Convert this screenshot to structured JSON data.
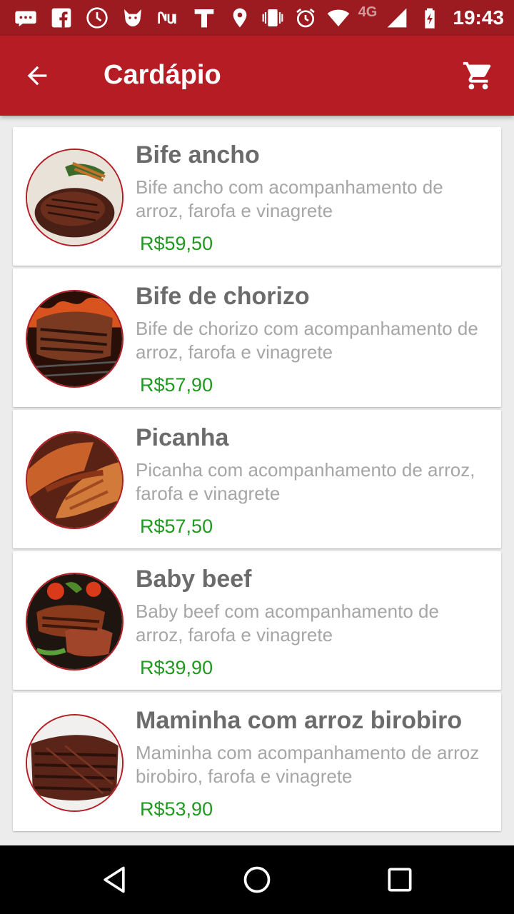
{
  "status_bar": {
    "network": "4G",
    "time": "19:43",
    "left_icons": [
      "message-icon",
      "facebook-icon",
      "clock-app-icon",
      "fox-app-icon",
      "nu-app-icon",
      "t-app-icon"
    ],
    "right_icons": [
      "location-icon",
      "vibrate-icon",
      "alarm-icon",
      "wifi-icon",
      "signal-icon",
      "battery-charging-icon"
    ]
  },
  "app_bar": {
    "title": "Cardápio",
    "back_icon": "arrow-back-icon",
    "cart_icon": "shopping-cart-icon",
    "color": "#b51c24"
  },
  "menu": {
    "items": [
      {
        "name": "Bife ancho",
        "description": "Bife ancho com acompanhamento de arroz, farofa e vinagrete",
        "price": "R$59,50"
      },
      {
        "name": "Bife de chorizo",
        "description": "Bife de chorizo com acompanhamento de arroz, farofa e vinagrete",
        "price": "R$57,90"
      },
      {
        "name": "Picanha",
        "description": "Picanha com acompanhamento de arroz, farofa e vinagrete",
        "price": "R$57,50"
      },
      {
        "name": "Baby beef",
        "description": "Baby beef com acompanhamento de arroz, farofa e vinagrete",
        "price": "R$39,90"
      },
      {
        "name": "Maminha com arroz birobiro",
        "description": "Maminha com acompanhamento de arroz birobiro, farofa e vinagrete",
        "price": "R$53,90"
      }
    ]
  },
  "nav_bar": {
    "buttons": [
      "back-triangle-icon",
      "home-circle-icon",
      "recents-square-icon"
    ]
  },
  "colors": {
    "status_bar": "#9b1b21",
    "price": "#1f9a1f",
    "title_text": "#6b6b6b",
    "description_text": "#a6a6a6"
  }
}
